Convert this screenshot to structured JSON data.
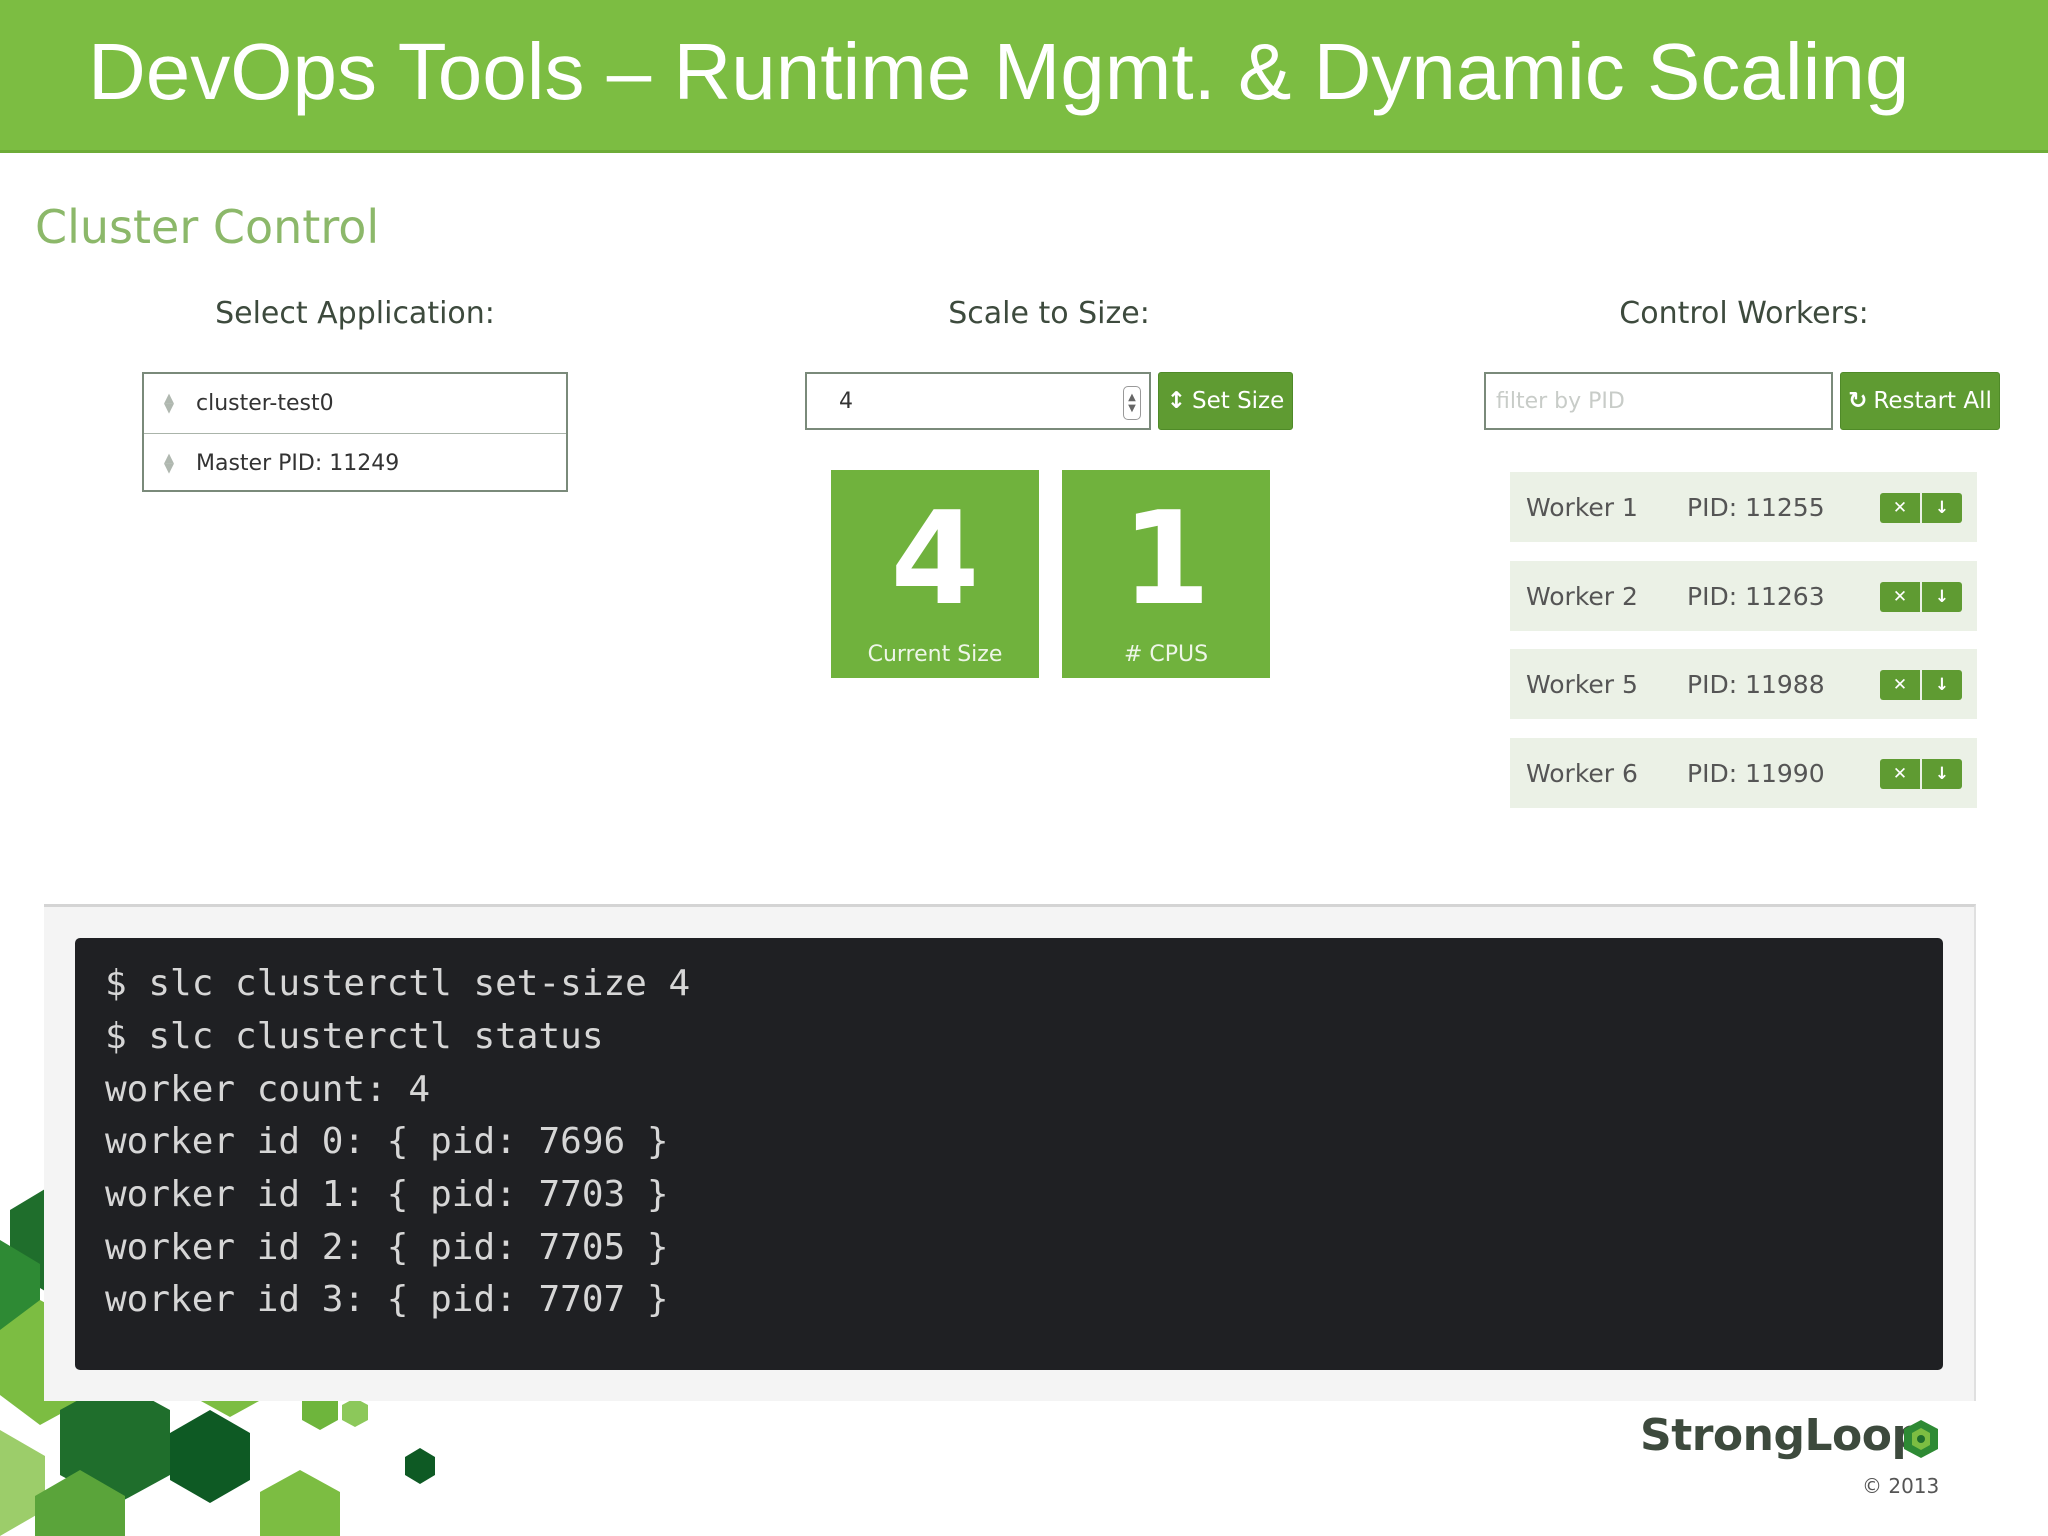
{
  "slide": {
    "title": "DevOps Tools – Runtime Mgmt. & Dynamic Scaling"
  },
  "panel": {
    "title": "Cluster Control"
  },
  "select_application": {
    "label": "Select Application:",
    "app": "cluster-test0",
    "master": "Master PID: 11249"
  },
  "scale": {
    "label": "Scale to Size:",
    "input_value": "4",
    "set_size_label": "Set Size",
    "set_size_icon": "resize-vertical-icon",
    "tiles": [
      {
        "value": "4",
        "label": "Current Size"
      },
      {
        "value": "1",
        "label": "# CPUS"
      }
    ]
  },
  "control_workers": {
    "label": "Control Workers:",
    "filter_placeholder": "filter by PID",
    "restart_label": "Restart All",
    "restart_icon": "refresh-icon",
    "workers": [
      {
        "name": "Worker 1",
        "pid": "PID: 11255"
      },
      {
        "name": "Worker 2",
        "pid": "PID: 11263"
      },
      {
        "name": "Worker 5",
        "pid": "PID: 11988"
      },
      {
        "name": "Worker 6",
        "pid": "PID: 11990"
      }
    ]
  },
  "terminal": {
    "lines": [
      "$ slc clusterctl set-size 4",
      "$ slc clusterctl status",
      "worker count: 4",
      "worker id 0: { pid: 7696 }",
      "worker id 1: { pid: 7703 }",
      "worker id 2: { pid: 7705 }",
      "worker id 3: { pid: 7707 }"
    ]
  },
  "brand": {
    "name": "StrongLoop",
    "copyright": "© 2013"
  },
  "colors": {
    "banner": "#7cbd42",
    "button_green": "#5f9b32",
    "tile_green": "#70b23d",
    "terminal_bg": "#1f2023"
  }
}
